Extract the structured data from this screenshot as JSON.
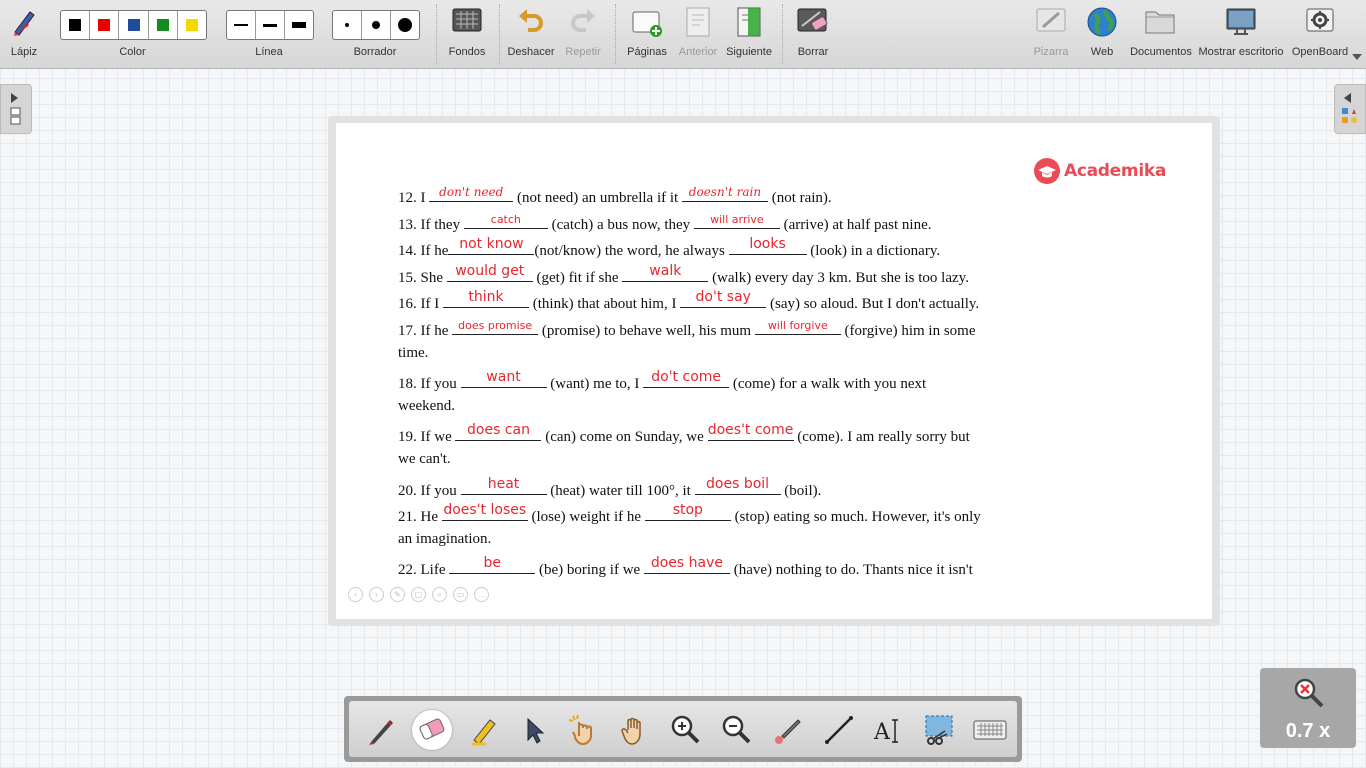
{
  "toolbar": {
    "pen_label": "Lápiz",
    "color_label": "Color",
    "colors": [
      "#000000",
      "#e60000",
      "#1e4b9a",
      "#138d1f",
      "#f5d800"
    ],
    "line_label": "Línea",
    "eraser_label": "Borrador",
    "backgrounds_label": "Fondos",
    "undo_label": "Deshacer",
    "redo_label": "Repetir",
    "pages_label": "Páginas",
    "previous_label": "Anterior",
    "next_label": "Siguiente",
    "clear_label": "Borrar",
    "board_label": "Pizarra",
    "web_label": "Web",
    "documents_label": "Documentos",
    "desktop_label": "Mostrar escritorio",
    "openboard_label": "OpenBoard"
  },
  "document": {
    "logo_text": "Academika",
    "lines": [
      {
        "parts": [
          {
            "t": "12. I "
          },
          {
            "a": "don't need",
            "w": 84,
            "s": "hw"
          },
          {
            "t": " (not need) an umbrella if it "
          },
          {
            "a": "doesn't rain",
            "w": 86,
            "s": "hw"
          },
          {
            "t": " (not rain)."
          }
        ]
      },
      {
        "parts": [
          {
            "t": "13. If they "
          },
          {
            "a": "catch",
            "w": 84,
            "s": "sm"
          },
          {
            "t": " (catch) a bus now, they "
          },
          {
            "a": "will arrive",
            "w": 86,
            "s": "sm"
          },
          {
            "t": " (arrive) at half past nine."
          }
        ]
      },
      {
        "parts": [
          {
            "t": " 14.  If he"
          },
          {
            "a": "not know",
            "w": 86,
            "s": "md"
          },
          {
            "t": "(not/know) the word, he always "
          },
          {
            "a": "looks",
            "w": 78,
            "s": "md"
          },
          {
            "t": " (look) in a dictionary."
          }
        ]
      },
      {
        "parts": [
          {
            "t": "15. She "
          },
          {
            "a": "would get",
            "w": 86,
            "s": "md"
          },
          {
            "t": " (get) fit if she "
          },
          {
            "a": "walk",
            "w": 86,
            "s": "md"
          },
          {
            "t": " (walk) every day 3 km. But she is too lazy."
          }
        ]
      },
      {
        "parts": [
          {
            "t": "16. If I "
          },
          {
            "a": "think",
            "w": 86,
            "s": "md"
          },
          {
            "t": " (think) that about him, I "
          },
          {
            "a": "do't say",
            "w": 86,
            "s": "md"
          },
          {
            "t": " (say) so aloud. But I don't actually."
          }
        ]
      },
      {
        "parts": [
          {
            "t": "17. If he "
          },
          {
            "a": "does promise",
            "w": 86,
            "s": "sm"
          },
          {
            "t": " (promise) to behave well, his mum "
          },
          {
            "a": "will forgive",
            "w": 86,
            "s": "sm"
          },
          {
            "t": " (forgive) him in some"
          }
        ]
      },
      {
        "parts": [
          {
            "t": "time."
          }
        ]
      },
      {
        "parts": [
          {
            "t": "18. If you "
          },
          {
            "a": "want",
            "w": 86,
            "s": "md"
          },
          {
            "t": " (want) me to, I "
          },
          {
            "a": "do't come",
            "w": 86,
            "s": "md"
          },
          {
            "t": " (come) for a walk with you next"
          }
        ]
      },
      {
        "parts": [
          {
            "t": "weekend."
          }
        ]
      },
      {
        "parts": [
          {
            "t": "19. If we "
          },
          {
            "a": "does can",
            "w": 86,
            "s": "md"
          },
          {
            "t": " (can) come on Sunday, we "
          },
          {
            "a": "does't come",
            "w": 86,
            "s": "md"
          },
          {
            "t": " (come). I am really sorry but"
          }
        ]
      },
      {
        "parts": [
          {
            "t": "we can't."
          }
        ]
      },
      {
        "parts": [
          {
            "t": "20. If you "
          },
          {
            "a": "heat",
            "w": 86,
            "s": "md"
          },
          {
            "t": " (heat) water till 100°, it "
          },
          {
            "a": "does boil",
            "w": 86,
            "s": "md"
          },
          {
            "t": " (boil)."
          }
        ]
      },
      {
        "parts": [
          {
            "t": "21. He "
          },
          {
            "a": "does't loses",
            "w": 86,
            "s": "md"
          },
          {
            "t": " (lose) weight if he "
          },
          {
            "a": "stop",
            "w": 86,
            "s": "md"
          },
          {
            "t": " (stop) eating so much. However, it's only"
          }
        ]
      },
      {
        "parts": [
          {
            "t": "an imagination."
          }
        ]
      },
      {
        "parts": [
          {
            "t": "22. Life "
          },
          {
            "a": "be",
            "w": 86,
            "s": "md"
          },
          {
            "t": " (be) boring if we "
          },
          {
            "a": "does have",
            "w": 86,
            "s": "md"
          },
          {
            "t": " (have) nothing to do. Thants nice it isn't"
          }
        ]
      }
    ]
  },
  "zoom": {
    "level": "0.7 x"
  },
  "icons": {
    "bottom_tools": [
      "pen-icon",
      "eraser-icon",
      "marker-icon",
      "selector-icon",
      "interact-icon",
      "hand-icon",
      "zoom-in-icon",
      "zoom-out-icon",
      "laser-pointer-icon",
      "line-icon",
      "text-icon",
      "capture-icon",
      "keyboard-icon"
    ]
  }
}
